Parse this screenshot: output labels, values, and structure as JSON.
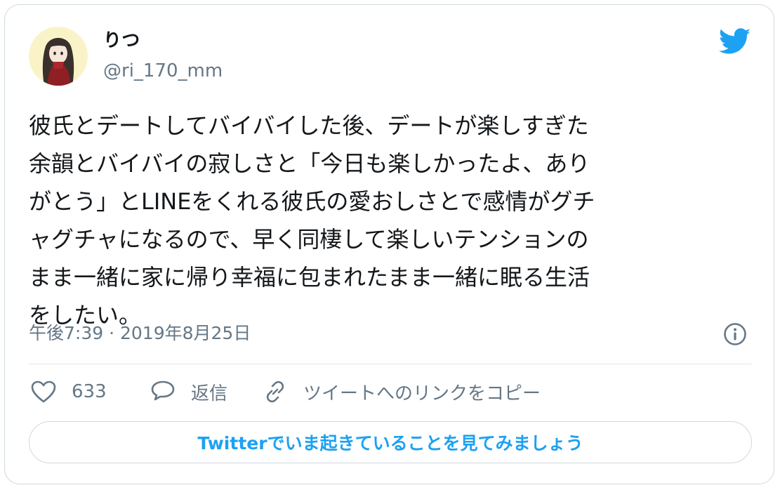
{
  "user": {
    "display_name": "りつ",
    "handle": "@ri_170_mm"
  },
  "tweet": {
    "text": "彼氏とデートしてバイバイした後、デートが楽しすぎた\n余韻とバイバイの寂しさと「今日も楽しかったよ、あり\nがとう」とLINEをくれる彼氏の愛おしさとで感情がグチ\nャグチャになるので、早く同棲して楽しいテンションの\nまま一緒に家に帰り幸福に包まれたまま一緒に眠る生活\nをしたい。",
    "timestamp": "午後7:39 · 2019年8月25日"
  },
  "actions": {
    "like_count": "633",
    "reply_label": "返信",
    "copy_link_label": "ツイートへのリンクをコピー"
  },
  "cta": {
    "label": "Twitterでいま起きていることを見てみましょう"
  },
  "colors": {
    "brand": "#1da1f2",
    "text": "#14171a",
    "secondary": "#657786",
    "border": "#cfd9de"
  },
  "icons": [
    "avatar",
    "twitter-bird-icon",
    "info-icon",
    "heart-icon",
    "reply-icon",
    "link-icon"
  ]
}
